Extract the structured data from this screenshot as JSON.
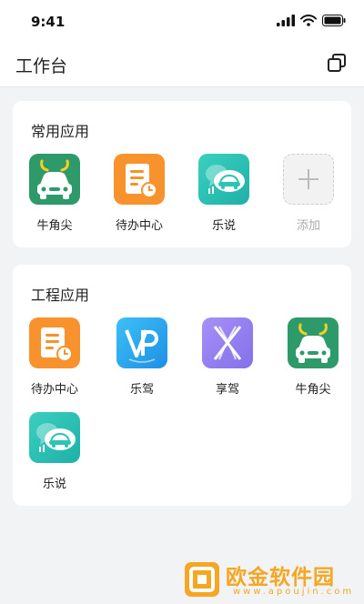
{
  "status": {
    "time": "9:41"
  },
  "header": {
    "title": "工作台"
  },
  "common": {
    "title": "常用应用",
    "apps": [
      {
        "label": "牛角尖",
        "icon": "bull-car-icon"
      },
      {
        "label": "待办中心",
        "icon": "todo-document-icon"
      },
      {
        "label": "乐说",
        "icon": "chat-car-icon"
      },
      {
        "label": "添加",
        "icon": "add-icon"
      }
    ]
  },
  "engineering": {
    "title": "工程应用",
    "apps": [
      {
        "label": "待办中心",
        "icon": "todo-document-icon"
      },
      {
        "label": "乐驾",
        "icon": "vp-logo-icon"
      },
      {
        "label": "享驾",
        "icon": "x-logo-icon"
      },
      {
        "label": "牛角尖",
        "icon": "bull-car-icon"
      },
      {
        "label": "乐说",
        "icon": "chat-car-icon"
      }
    ]
  },
  "watermark": {
    "text": "欧金软件园",
    "url": "www.apoujin.com"
  },
  "colors": {
    "green": "#2e9a6a",
    "orange": "#f7922c",
    "teal": "#2cc4b4",
    "blue": "#2ea7f0",
    "purple": "#9a84f2"
  }
}
